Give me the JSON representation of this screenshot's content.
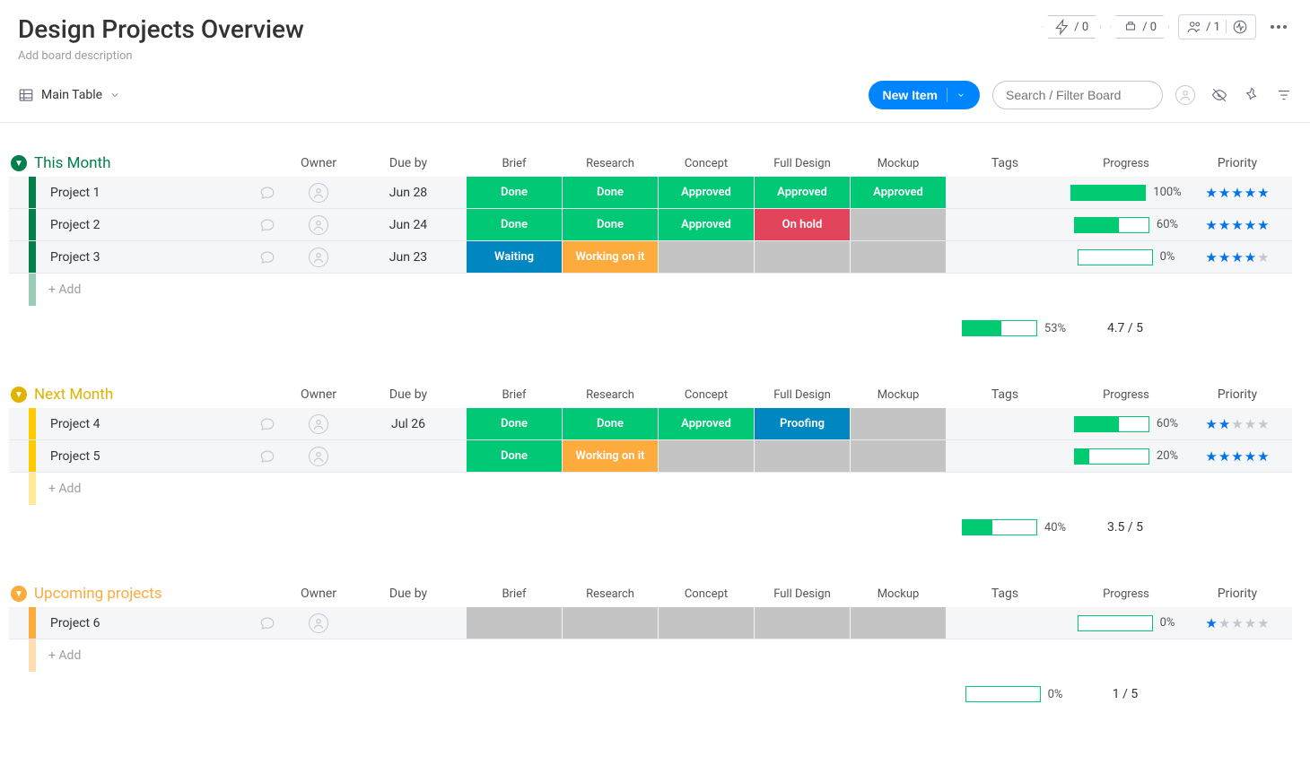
{
  "header": {
    "title": "Design Projects Overview",
    "description_placeholder": "Add board description",
    "chips": {
      "automations": "/ 0",
      "integrations": "/ 0",
      "members": "/ 1"
    }
  },
  "toolbar": {
    "view": "Main Table",
    "new_item": "New Item",
    "search_placeholder": "Search / Filter Board"
  },
  "columns": [
    "Owner",
    "Due by",
    "Brief",
    "Research",
    "Concept",
    "Full Design",
    "Mockup",
    "Tags",
    "Progress",
    "Priority"
  ],
  "status_colors": {
    "Done": "#00c875",
    "Approved": "#00c875",
    "Waiting": "#0086c0",
    "Working on it": "#fdab3d",
    "On hold": "#e2445c",
    "Proofing": "#0086c0",
    "": "#c4c4c4"
  },
  "groups": [
    {
      "name": "This Month",
      "color": "#037f4c",
      "title_color": "#037f4c",
      "items": [
        {
          "name": "Project 1",
          "due": "Jun 28",
          "statuses": [
            "Done",
            "Done",
            "Approved",
            "Approved",
            "Approved"
          ],
          "progress": 100,
          "stars": 5
        },
        {
          "name": "Project 2",
          "due": "Jun 24",
          "statuses": [
            "Done",
            "Done",
            "Approved",
            "On hold",
            ""
          ],
          "progress": 60,
          "stars": 5
        },
        {
          "name": "Project 3",
          "due": "Jun 23",
          "statuses": [
            "Waiting",
            "Working on it",
            "",
            "",
            ""
          ],
          "progress": 0,
          "stars": 4
        }
      ],
      "summary": {
        "progress": 53,
        "priority": "4.7 / 5"
      },
      "add_label": "+ Add"
    },
    {
      "name": "Next Month",
      "color": "#ffcb00",
      "title_color": "#e2b203",
      "items": [
        {
          "name": "Project 4",
          "due": "Jul 26",
          "statuses": [
            "Done",
            "Done",
            "Approved",
            "Proofing",
            ""
          ],
          "progress": 60,
          "stars": 2
        },
        {
          "name": "Project 5",
          "due": "",
          "statuses": [
            "Done",
            "Working on it",
            "",
            "",
            ""
          ],
          "progress": 20,
          "stars": 5
        }
      ],
      "summary": {
        "progress": 40,
        "priority": "3.5 / 5"
      },
      "add_label": "+ Add"
    },
    {
      "name": "Upcoming projects",
      "color": "#fdab3d",
      "title_color": "#fdab3d",
      "items": [
        {
          "name": "Project 6",
          "due": "",
          "statuses": [
            "",
            "",
            "",
            "",
            ""
          ],
          "progress": 0,
          "stars": 1
        }
      ],
      "summary": {
        "progress": 0,
        "priority": "1 / 5"
      },
      "add_label": "+ Add"
    }
  ]
}
